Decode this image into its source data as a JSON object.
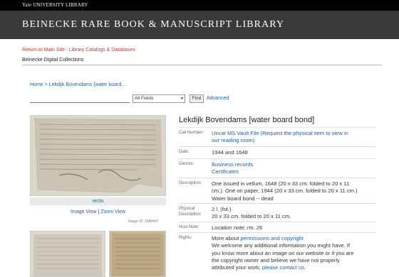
{
  "topbar": {
    "brand": "Yale UNIVERSITY LIBRARY"
  },
  "header": {
    "library_name": "BEINECKE RARE BOOK & MANUSCRIPT LIBRARY"
  },
  "toplinks": {
    "main_site": "Return to Main Site",
    "separator": " : ",
    "catalogs": "Library Catalogs & Databases"
  },
  "subtitle": "Beinecke Digital Collections",
  "breadcrumb": {
    "home": "Home",
    "separator": " > ",
    "current": "Lekdijk Bovendams [water board..."
  },
  "search": {
    "query": "",
    "field_selected": "All Fields",
    "find_label": "Find",
    "advanced_label": "Advanced"
  },
  "image": {
    "caption": "recto",
    "image_view": "Image View",
    "separator": " | ",
    "zoom_view": "Zoom View",
    "image_id": "Image ID: 1046407"
  },
  "record": {
    "title": "Lekdijk Bovendams [water board bond]",
    "call_number_label": "Call Number:",
    "call_number_lines": [
      "Uncat MS Vault File  (Request the physical item to view in",
      "our reading room)"
    ],
    "date_label": "Date:",
    "date": "1944 and 1648",
    "genres_label": "Genres:",
    "genres": [
      "Business records",
      "Certificates"
    ],
    "description_label": "Description:",
    "description_lines": [
      "One issued in vellum, 1648 (20 x 33 cm. folded to 20 x 11",
      "cm.). One on paper, 1944 (20 x 33 cm. folded to 20 x 11 cm.)",
      "Water board bond -- dead"
    ],
    "physical_label_1": "Physical",
    "physical_label_2": "Description:",
    "physical_lines": [
      "2 l. (fol.)",
      "20 x 33 cm. folded to 20 x 11 cm."
    ],
    "host_note_label": "Host Note:",
    "host_note": "Location note: rm. 26",
    "rights_label": "Rights:",
    "rights_intro": "More about ",
    "rights_link": "permissions and copyright",
    "rights_lines": [
      "We welcome any additional information you might have. If",
      "you know more about an image on our website or if you are",
      "the copyright owner and believe we have not properly"
    ],
    "rights_last": "attributed your work, ",
    "rights_contact": "please contact us",
    "rights_period": "."
  },
  "colors": {
    "accent_link": "#1a5fb4",
    "top_link": "#c0392b",
    "header_bg": "#3a3a3a"
  }
}
